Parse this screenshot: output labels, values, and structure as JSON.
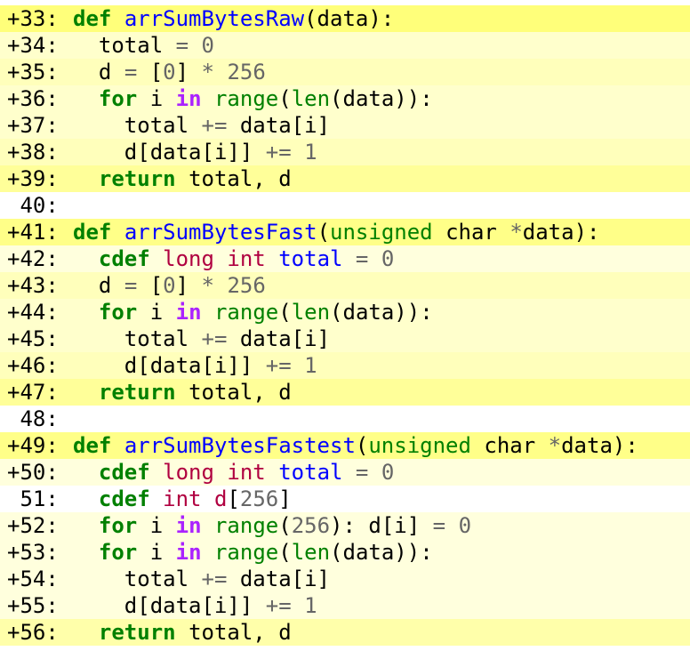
{
  "colors": {
    "shades": [
      "#ffffff",
      "#ffff7a",
      "#ffff88",
      "#ffff99",
      "#ffffaa",
      "#ffffbb",
      "#ffffcc",
      "#ffffdd"
    ],
    "keyword": "#008000",
    "function_name": "#0000ff",
    "operator": "#666666",
    "in_keyword": "#aa22ff",
    "c_type": "#b00040"
  },
  "lines": [
    {
      "num": "+33:",
      "shade": 1,
      "tokens": [
        [
          "kw",
          "def"
        ],
        [
          "ws",
          " "
        ],
        [
          "fn",
          "arrSumBytesRaw"
        ],
        [
          "punct",
          "(data):"
        ]
      ]
    },
    {
      "num": "+34:",
      "shade": 6,
      "tokens": [
        [
          "ws",
          "  "
        ],
        [
          "name",
          "total"
        ],
        [
          "ws",
          " "
        ],
        [
          "op",
          "="
        ],
        [
          "ws",
          " "
        ],
        [
          "num",
          "0"
        ]
      ]
    },
    {
      "num": "+35:",
      "shade": 5,
      "tokens": [
        [
          "ws",
          "  "
        ],
        [
          "name",
          "d"
        ],
        [
          "ws",
          " "
        ],
        [
          "op",
          "="
        ],
        [
          "ws",
          " "
        ],
        [
          "punct",
          "["
        ],
        [
          "num",
          "0"
        ],
        [
          "punct",
          "]"
        ],
        [
          "ws",
          " "
        ],
        [
          "op",
          "*"
        ],
        [
          "ws",
          " "
        ],
        [
          "num",
          "256"
        ]
      ]
    },
    {
      "num": "+36:",
      "shade": 6,
      "tokens": [
        [
          "ws",
          "  "
        ],
        [
          "kw",
          "for"
        ],
        [
          "ws",
          " "
        ],
        [
          "name",
          "i"
        ],
        [
          "ws",
          " "
        ],
        [
          "in",
          "in"
        ],
        [
          "ws",
          " "
        ],
        [
          "bi",
          "range"
        ],
        [
          "punct",
          "("
        ],
        [
          "bi",
          "len"
        ],
        [
          "punct",
          "(data)):"
        ]
      ]
    },
    {
      "num": "+37:",
      "shade": 6,
      "tokens": [
        [
          "ws",
          "    "
        ],
        [
          "name",
          "total"
        ],
        [
          "ws",
          " "
        ],
        [
          "op",
          "+="
        ],
        [
          "ws",
          " "
        ],
        [
          "name",
          "data[i]"
        ]
      ]
    },
    {
      "num": "+38:",
      "shade": 5,
      "tokens": [
        [
          "ws",
          "    "
        ],
        [
          "name",
          "d[data[i]]"
        ],
        [
          "ws",
          " "
        ],
        [
          "op",
          "+="
        ],
        [
          "ws",
          " "
        ],
        [
          "num",
          "1"
        ]
      ]
    },
    {
      "num": "+39:",
      "shade": 3,
      "tokens": [
        [
          "ws",
          "  "
        ],
        [
          "kw",
          "return"
        ],
        [
          "ws",
          " "
        ],
        [
          "name",
          "total, d"
        ]
      ]
    },
    {
      "num": " 40:",
      "shade": 0,
      "tokens": []
    },
    {
      "num": "+41:",
      "shade": 2,
      "tokens": [
        [
          "kw",
          "def"
        ],
        [
          "ws",
          " "
        ],
        [
          "fn",
          "arrSumBytesFast"
        ],
        [
          "punct",
          "("
        ],
        [
          "bi",
          "unsigned"
        ],
        [
          "ws",
          " "
        ],
        [
          "name",
          "char"
        ],
        [
          "ws",
          " "
        ],
        [
          "op",
          "*"
        ],
        [
          "punct",
          "data):"
        ]
      ]
    },
    {
      "num": "+42:",
      "shade": 7,
      "tokens": [
        [
          "ws",
          "  "
        ],
        [
          "kw",
          "cdef"
        ],
        [
          "ws",
          " "
        ],
        [
          "ctype",
          "long"
        ],
        [
          "ws",
          " "
        ],
        [
          "ctype",
          "int"
        ],
        [
          "ws",
          " "
        ],
        [
          "fn",
          "total"
        ],
        [
          "ws",
          " "
        ],
        [
          "op",
          "="
        ],
        [
          "ws",
          " "
        ],
        [
          "num",
          "0"
        ]
      ]
    },
    {
      "num": "+43:",
      "shade": 5,
      "tokens": [
        [
          "ws",
          "  "
        ],
        [
          "name",
          "d"
        ],
        [
          "ws",
          " "
        ],
        [
          "op",
          "="
        ],
        [
          "ws",
          " "
        ],
        [
          "punct",
          "["
        ],
        [
          "num",
          "0"
        ],
        [
          "punct",
          "]"
        ],
        [
          "ws",
          " "
        ],
        [
          "op",
          "*"
        ],
        [
          "ws",
          " "
        ],
        [
          "num",
          "256"
        ]
      ]
    },
    {
      "num": "+44:",
      "shade": 6,
      "tokens": [
        [
          "ws",
          "  "
        ],
        [
          "kw",
          "for"
        ],
        [
          "ws",
          " "
        ],
        [
          "name",
          "i"
        ],
        [
          "ws",
          " "
        ],
        [
          "in",
          "in"
        ],
        [
          "ws",
          " "
        ],
        [
          "bi",
          "range"
        ],
        [
          "punct",
          "("
        ],
        [
          "bi",
          "len"
        ],
        [
          "punct",
          "(data)):"
        ]
      ]
    },
    {
      "num": "+45:",
      "shade": 6,
      "tokens": [
        [
          "ws",
          "    "
        ],
        [
          "name",
          "total"
        ],
        [
          "ws",
          " "
        ],
        [
          "op",
          "+="
        ],
        [
          "ws",
          " "
        ],
        [
          "name",
          "data[i]"
        ]
      ]
    },
    {
      "num": "+46:",
      "shade": 5,
      "tokens": [
        [
          "ws",
          "    "
        ],
        [
          "name",
          "d[data[i]]"
        ],
        [
          "ws",
          " "
        ],
        [
          "op",
          "+="
        ],
        [
          "ws",
          " "
        ],
        [
          "num",
          "1"
        ]
      ]
    },
    {
      "num": "+47:",
      "shade": 3,
      "tokens": [
        [
          "ws",
          "  "
        ],
        [
          "kw",
          "return"
        ],
        [
          "ws",
          " "
        ],
        [
          "name",
          "total, d"
        ]
      ]
    },
    {
      "num": " 48:",
      "shade": 0,
      "tokens": []
    },
    {
      "num": "+49:",
      "shade": 2,
      "tokens": [
        [
          "kw",
          "def"
        ],
        [
          "ws",
          " "
        ],
        [
          "fn",
          "arrSumBytesFastest"
        ],
        [
          "punct",
          "("
        ],
        [
          "bi",
          "unsigned"
        ],
        [
          "ws",
          " "
        ],
        [
          "name",
          "char"
        ],
        [
          "ws",
          " "
        ],
        [
          "op",
          "*"
        ],
        [
          "punct",
          "data):"
        ]
      ]
    },
    {
      "num": "+50:",
      "shade": 7,
      "tokens": [
        [
          "ws",
          "  "
        ],
        [
          "kw",
          "cdef"
        ],
        [
          "ws",
          " "
        ],
        [
          "ctype",
          "long"
        ],
        [
          "ws",
          " "
        ],
        [
          "ctype",
          "int"
        ],
        [
          "ws",
          " "
        ],
        [
          "fn",
          "total"
        ],
        [
          "ws",
          " "
        ],
        [
          "op",
          "="
        ],
        [
          "ws",
          " "
        ],
        [
          "num",
          "0"
        ]
      ]
    },
    {
      "num": " 51:",
      "shade": 0,
      "tokens": [
        [
          "ws",
          "  "
        ],
        [
          "kw",
          "cdef"
        ],
        [
          "ws",
          " "
        ],
        [
          "ctype",
          "int"
        ],
        [
          "ws",
          " "
        ],
        [
          "ctype",
          "d"
        ],
        [
          "punct",
          "["
        ],
        [
          "num",
          "256"
        ],
        [
          "punct",
          "]"
        ]
      ]
    },
    {
      "num": "+52:",
      "shade": 7,
      "tokens": [
        [
          "ws",
          "  "
        ],
        [
          "kw",
          "for"
        ],
        [
          "ws",
          " "
        ],
        [
          "name",
          "i"
        ],
        [
          "ws",
          " "
        ],
        [
          "in",
          "in"
        ],
        [
          "ws",
          " "
        ],
        [
          "bi",
          "range"
        ],
        [
          "punct",
          "("
        ],
        [
          "num",
          "256"
        ],
        [
          "punct",
          "):"
        ],
        [
          "ws",
          " "
        ],
        [
          "name",
          "d[i]"
        ],
        [
          "ws",
          " "
        ],
        [
          "op",
          "="
        ],
        [
          "ws",
          " "
        ],
        [
          "num",
          "0"
        ]
      ]
    },
    {
      "num": "+53:",
      "shade": 7,
      "tokens": [
        [
          "ws",
          "  "
        ],
        [
          "kw",
          "for"
        ],
        [
          "ws",
          " "
        ],
        [
          "name",
          "i"
        ],
        [
          "ws",
          " "
        ],
        [
          "in",
          "in"
        ],
        [
          "ws",
          " "
        ],
        [
          "bi",
          "range"
        ],
        [
          "punct",
          "("
        ],
        [
          "bi",
          "len"
        ],
        [
          "punct",
          "(data)):"
        ]
      ]
    },
    {
      "num": "+54:",
      "shade": 7,
      "tokens": [
        [
          "ws",
          "    "
        ],
        [
          "name",
          "total"
        ],
        [
          "ws",
          " "
        ],
        [
          "op",
          "+="
        ],
        [
          "ws",
          " "
        ],
        [
          "name",
          "data[i]"
        ]
      ]
    },
    {
      "num": "+55:",
      "shade": 7,
      "tokens": [
        [
          "ws",
          "    "
        ],
        [
          "name",
          "d[data[i]]"
        ],
        [
          "ws",
          " "
        ],
        [
          "op",
          "+="
        ],
        [
          "ws",
          " "
        ],
        [
          "num",
          "1"
        ]
      ]
    },
    {
      "num": "+56:",
      "shade": 4,
      "tokens": [
        [
          "ws",
          "  "
        ],
        [
          "kw",
          "return"
        ],
        [
          "ws",
          " "
        ],
        [
          "name",
          "total, d"
        ]
      ]
    }
  ]
}
